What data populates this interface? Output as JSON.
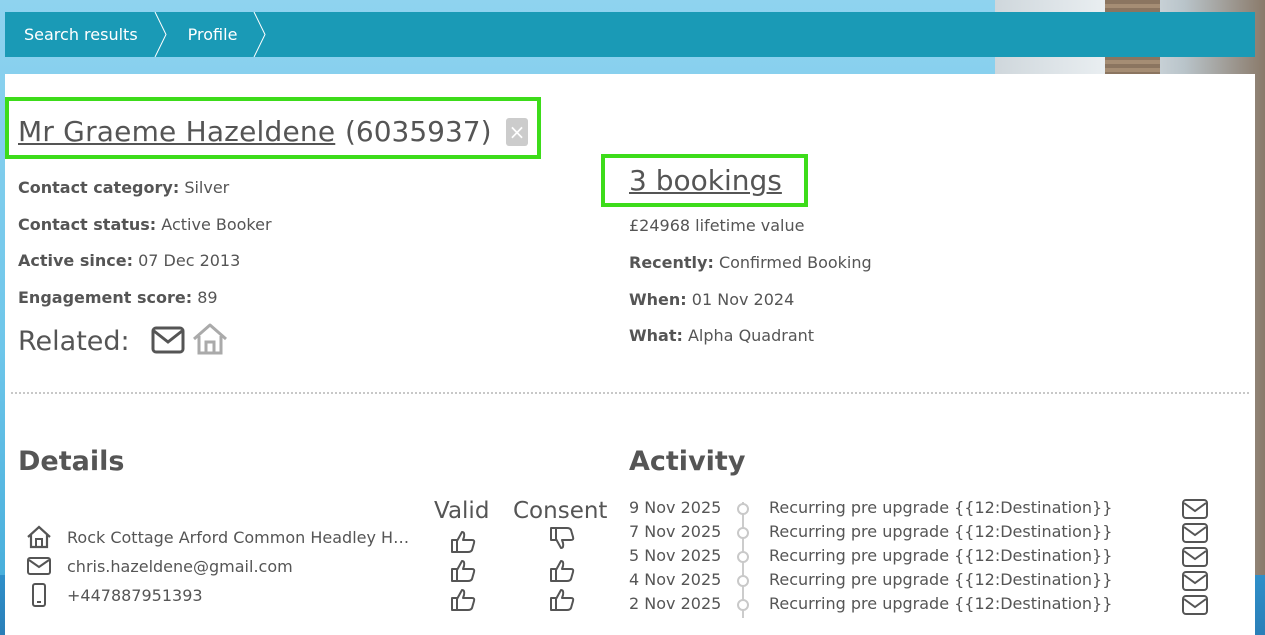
{
  "breadcrumb": {
    "items": [
      {
        "label": "Search results"
      },
      {
        "label": "Profile"
      }
    ]
  },
  "contact": {
    "name": "Mr Graeme Hazeldene",
    "id": "(6035937)",
    "fields": [
      {
        "label": "Contact category:",
        "value": "Silver"
      },
      {
        "label": "Contact status:",
        "value": "Active Booker"
      },
      {
        "label": "Active since:",
        "value": "07 Dec 2013"
      },
      {
        "label": "Engagement score:",
        "value": "89"
      }
    ],
    "related_label": "Related:"
  },
  "bookings": {
    "title": "3 bookings",
    "lifetime": "£24968 lifetime value",
    "fields": [
      {
        "label": "Recently:",
        "value": "Confirmed Booking"
      },
      {
        "label": "When:",
        "value": "01 Nov 2024"
      },
      {
        "label": "What:",
        "value": "Alpha Quadrant"
      }
    ]
  },
  "details": {
    "title": "Details",
    "col_valid": "Valid",
    "col_consent": "Consent",
    "rows": [
      {
        "icon": "home-icon",
        "text": "Rock Cottage Arford Common Headley Hampshire",
        "valid": "thumbs-up",
        "consent": "thumbs-down"
      },
      {
        "icon": "envelope-icon",
        "text": "chris.hazeldene@gmail.com",
        "valid": "thumbs-up",
        "consent": "thumbs-up"
      },
      {
        "icon": "mobile-phone-icon",
        "text": "+447887951393",
        "valid": "thumbs-up",
        "consent": "thumbs-up"
      }
    ]
  },
  "activity": {
    "title": "Activity",
    "items": [
      {
        "date": "9 Nov 2025",
        "text": "Recurring pre upgrade {{12:Destination}}"
      },
      {
        "date": "7 Nov 2025",
        "text": "Recurring pre upgrade {{12:Destination}}"
      },
      {
        "date": "5 Nov 2025",
        "text": "Recurring pre upgrade {{12:Destination}}"
      },
      {
        "date": "4 Nov 2025",
        "text": "Recurring pre upgrade {{12:Destination}}"
      },
      {
        "date": "2 Nov 2025",
        "text": "Recurring pre upgrade {{12:Destination}}"
      }
    ]
  },
  "colors": {
    "breadcrumb_bg": "#1a9ab6",
    "highlight": "#3ddc1a",
    "text": "#555555"
  }
}
